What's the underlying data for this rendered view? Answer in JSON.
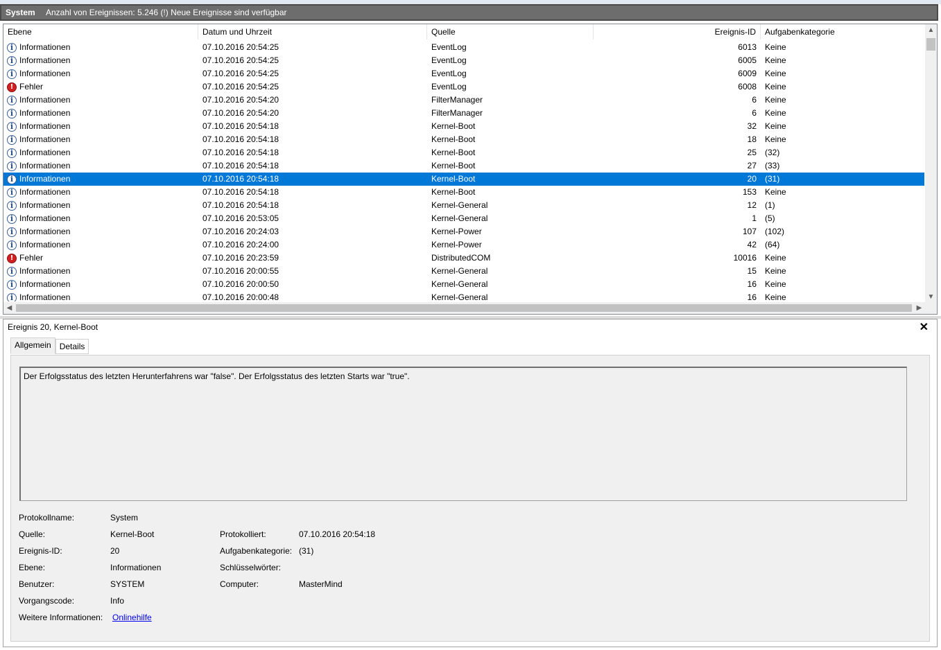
{
  "titlebar": {
    "log_name": "System",
    "status": "Anzahl von Ereignissen: 5.246 (!) Neue Ereignisse sind verfügbar"
  },
  "columns": {
    "level": "Ebene",
    "datetime": "Datum und Uhrzeit",
    "source": "Quelle",
    "event_id": "Ereignis-ID",
    "task_category": "Aufgabenkategorie"
  },
  "events": [
    {
      "level": "Informationen",
      "type": "info",
      "datetime": "07.10.2016 20:54:25",
      "source": "EventLog",
      "event_id": "6013",
      "task": "Keine"
    },
    {
      "level": "Informationen",
      "type": "info",
      "datetime": "07.10.2016 20:54:25",
      "source": "EventLog",
      "event_id": "6005",
      "task": "Keine"
    },
    {
      "level": "Informationen",
      "type": "info",
      "datetime": "07.10.2016 20:54:25",
      "source": "EventLog",
      "event_id": "6009",
      "task": "Keine"
    },
    {
      "level": "Fehler",
      "type": "error",
      "datetime": "07.10.2016 20:54:25",
      "source": "EventLog",
      "event_id": "6008",
      "task": "Keine"
    },
    {
      "level": "Informationen",
      "type": "info",
      "datetime": "07.10.2016 20:54:20",
      "source": "FilterManager",
      "event_id": "6",
      "task": "Keine"
    },
    {
      "level": "Informationen",
      "type": "info",
      "datetime": "07.10.2016 20:54:20",
      "source": "FilterManager",
      "event_id": "6",
      "task": "Keine"
    },
    {
      "level": "Informationen",
      "type": "info",
      "datetime": "07.10.2016 20:54:18",
      "source": "Kernel-Boot",
      "event_id": "32",
      "task": "Keine"
    },
    {
      "level": "Informationen",
      "type": "info",
      "datetime": "07.10.2016 20:54:18",
      "source": "Kernel-Boot",
      "event_id": "18",
      "task": "Keine"
    },
    {
      "level": "Informationen",
      "type": "info",
      "datetime": "07.10.2016 20:54:18",
      "source": "Kernel-Boot",
      "event_id": "25",
      "task": "(32)"
    },
    {
      "level": "Informationen",
      "type": "info",
      "datetime": "07.10.2016 20:54:18",
      "source": "Kernel-Boot",
      "event_id": "27",
      "task": "(33)"
    },
    {
      "level": "Informationen",
      "type": "info",
      "datetime": "07.10.2016 20:54:18",
      "source": "Kernel-Boot",
      "event_id": "20",
      "task": "(31)",
      "selected": true
    },
    {
      "level": "Informationen",
      "type": "info",
      "datetime": "07.10.2016 20:54:18",
      "source": "Kernel-Boot",
      "event_id": "153",
      "task": "Keine"
    },
    {
      "level": "Informationen",
      "type": "info",
      "datetime": "07.10.2016 20:54:18",
      "source": "Kernel-General",
      "event_id": "12",
      "task": "(1)"
    },
    {
      "level": "Informationen",
      "type": "info",
      "datetime": "07.10.2016 20:53:05",
      "source": "Kernel-General",
      "event_id": "1",
      "task": "(5)"
    },
    {
      "level": "Informationen",
      "type": "info",
      "datetime": "07.10.2016 20:24:03",
      "source": "Kernel-Power",
      "event_id": "107",
      "task": "(102)"
    },
    {
      "level": "Informationen",
      "type": "info",
      "datetime": "07.10.2016 20:24:00",
      "source": "Kernel-Power",
      "event_id": "42",
      "task": "(64)"
    },
    {
      "level": "Fehler",
      "type": "error",
      "datetime": "07.10.2016 20:23:59",
      "source": "DistributedCOM",
      "event_id": "10016",
      "task": "Keine"
    },
    {
      "level": "Informationen",
      "type": "info",
      "datetime": "07.10.2016 20:00:55",
      "source": "Kernel-General",
      "event_id": "15",
      "task": "Keine"
    },
    {
      "level": "Informationen",
      "type": "info",
      "datetime": "07.10.2016 20:00:50",
      "source": "Kernel-General",
      "event_id": "16",
      "task": "Keine"
    },
    {
      "level": "Informationen",
      "type": "info",
      "datetime": "07.10.2016 20:00:48",
      "source": "Kernel-General",
      "event_id": "16",
      "task": "Keine"
    }
  ],
  "detail": {
    "title": "Ereignis 20, Kernel-Boot",
    "tabs": {
      "general": "Allgemein",
      "details": "Details"
    },
    "description": "Der Erfolgsstatus des letzten Herunterfahrens war \"false\". Der Erfolgsstatus des letzten Starts war \"true\".",
    "labels": {
      "log_name": "Protokollname:",
      "source": "Quelle:",
      "event_id": "Ereignis-ID:",
      "level": "Ebene:",
      "user": "Benutzer:",
      "opcode": "Vorgangscode:",
      "more_info": "Weitere Informationen:",
      "logged": "Protokolliert:",
      "task_category": "Aufgabenkategorie:",
      "keywords": "Schlüsselwörter:",
      "computer": "Computer:"
    },
    "values": {
      "log_name": "System",
      "source": "Kernel-Boot",
      "event_id": "20",
      "level": "Informationen",
      "user": "SYSTEM",
      "opcode": "Info",
      "more_info_link": "Onlinehilfe",
      "logged": "07.10.2016 20:54:18",
      "task_category": "(31)",
      "keywords": "",
      "computer": "MasterMind"
    }
  },
  "colors": {
    "selection": "#0078d7",
    "titlebar": "#6d6d6d",
    "panel_bg": "#f0f0f0",
    "error_icon": "#d02020",
    "info_icon": "#244a86"
  }
}
